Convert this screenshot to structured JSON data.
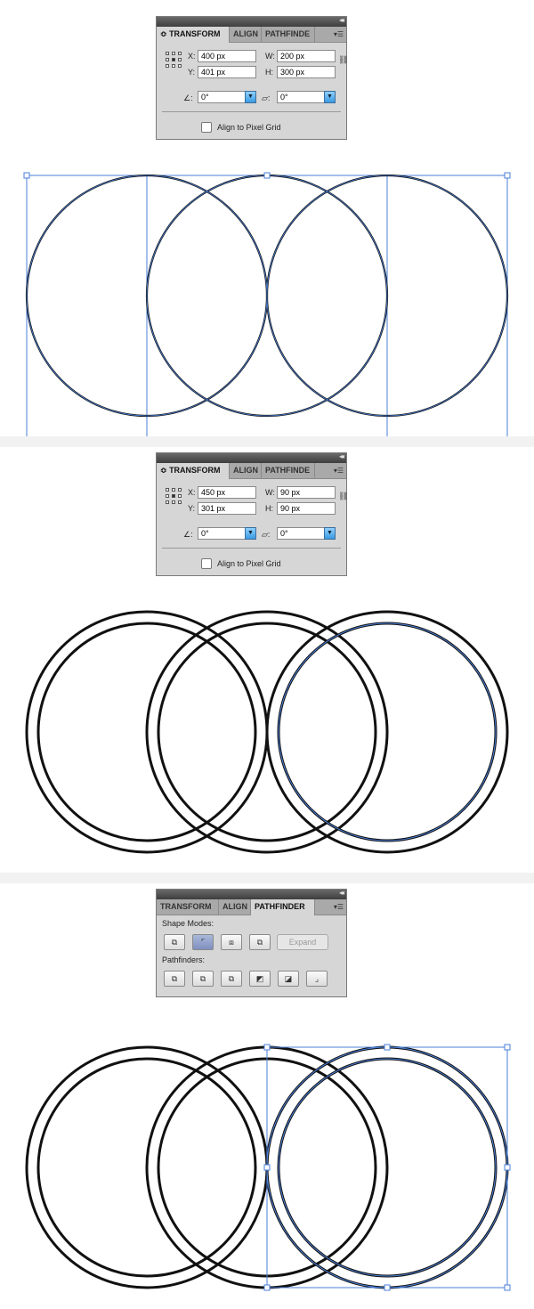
{
  "colors": {
    "selection": "#4a7fd8",
    "stroke": "#111111",
    "panel_bg": "#d6d6d6",
    "button_blue": "#3a9ae0"
  },
  "panel1": {
    "tabs": [
      "TRANSFORM",
      "ALIGN",
      "PATHFINDE"
    ],
    "x_label": "X:",
    "x_value": "400 px",
    "y_label": "Y:",
    "y_value": "401 px",
    "w_label": "W:",
    "w_value": "200 px",
    "h_label": "H:",
    "h_value": "300 px",
    "rotate_value": "0°",
    "shear_value": "0°",
    "pixel_grid_label": "Align to Pixel Grid",
    "tab_prefix": "≎"
  },
  "panel2": {
    "tabs": [
      "TRANSFORM",
      "ALIGN",
      "PATHFINDE"
    ],
    "x_label": "X:",
    "x_value": "450 px",
    "y_label": "Y:",
    "y_value": "301 px",
    "w_label": "W:",
    "w_value": "90 px",
    "h_label": "H:",
    "h_value": "90 px",
    "rotate_value": "0°",
    "shear_value": "0°",
    "pixel_grid_label": "Align to Pixel Grid",
    "tab_prefix": "≎"
  },
  "panel3": {
    "tabs": [
      "TRANSFORM",
      "ALIGN",
      "PATHFINDER"
    ],
    "shape_modes_label": "Shape Modes:",
    "pathfinders_label": "Pathfinders:",
    "expand_label": "Expand"
  }
}
